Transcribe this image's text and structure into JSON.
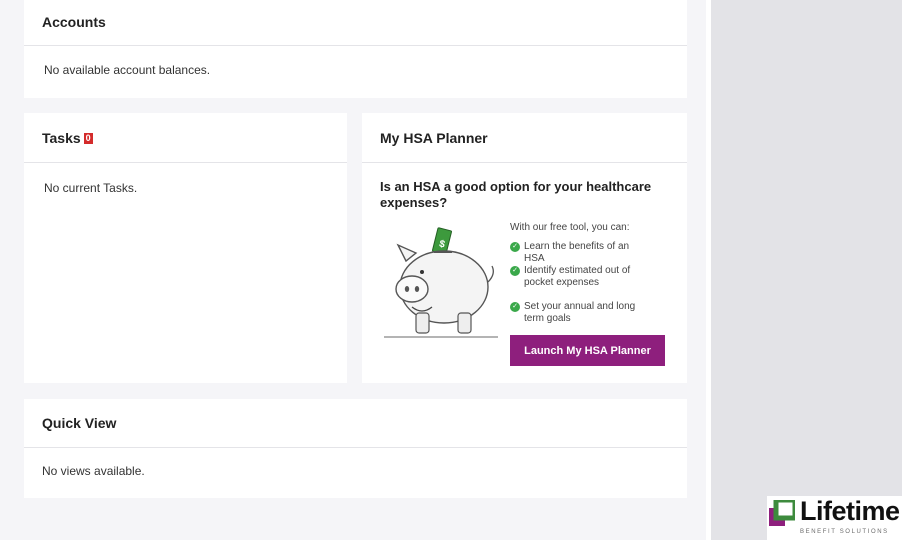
{
  "accounts": {
    "title": "Accounts",
    "empty": "No available account balances."
  },
  "tasks": {
    "title": "Tasks",
    "count": "0",
    "empty": "No current Tasks."
  },
  "hsa_planner": {
    "title": "My HSA Planner",
    "question": "Is an HSA a good option for your healthcare expenses?",
    "intro": "With our free tool, you can:",
    "benefits": [
      "Learn the benefits of an HSA",
      "Identify estimated out of pocket expenses",
      "Set your annual and long term goals"
    ],
    "button_label": "Launch My HSA Planner",
    "bill_symbol": "$"
  },
  "quick_view": {
    "title": "Quick View",
    "empty": "No views available."
  },
  "logo": {
    "name": "Lifetime",
    "tagline": "BENEFIT SOLUTIONS"
  },
  "colors": {
    "accent": "#8e1f7d",
    "badge": "#d42b2b",
    "check": "#3aa84a",
    "logo_green": "#3d8b3d"
  },
  "icons": {
    "check": "check-circle-icon",
    "piggy": "piggy-bank-illustration"
  }
}
